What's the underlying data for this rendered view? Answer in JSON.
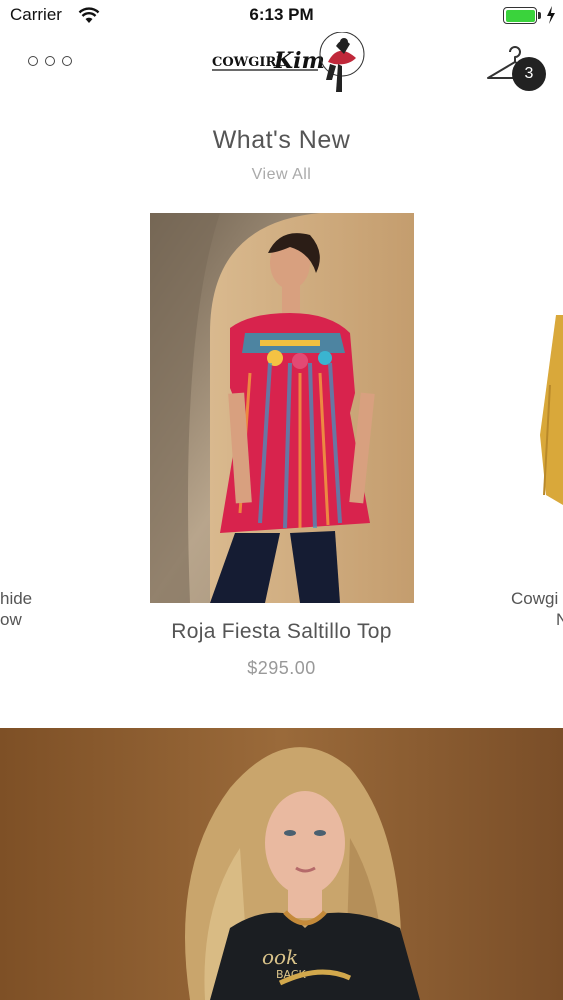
{
  "status_bar": {
    "carrier": "Carrier",
    "time": "6:13 PM",
    "battery_color": "#3ad33c"
  },
  "nav": {
    "menu_icon": "more-dots-icon",
    "logo_text": "COWGIRL Kim",
    "cart_icon": "hanger-icon",
    "cart_count": "3"
  },
  "section": {
    "title": "What's New",
    "view_all": "View All"
  },
  "carousel": {
    "left_partial_text": [
      "hide",
      "ow"
    ],
    "current": {
      "name": "Roja Fiesta Saltillo Top",
      "price": "$295.00"
    },
    "right_partial_text": [
      "Cowgi",
      "N"
    ]
  },
  "colors": {
    "text": "#555555",
    "muted": "#aaaaaa",
    "badge": "#222222"
  }
}
